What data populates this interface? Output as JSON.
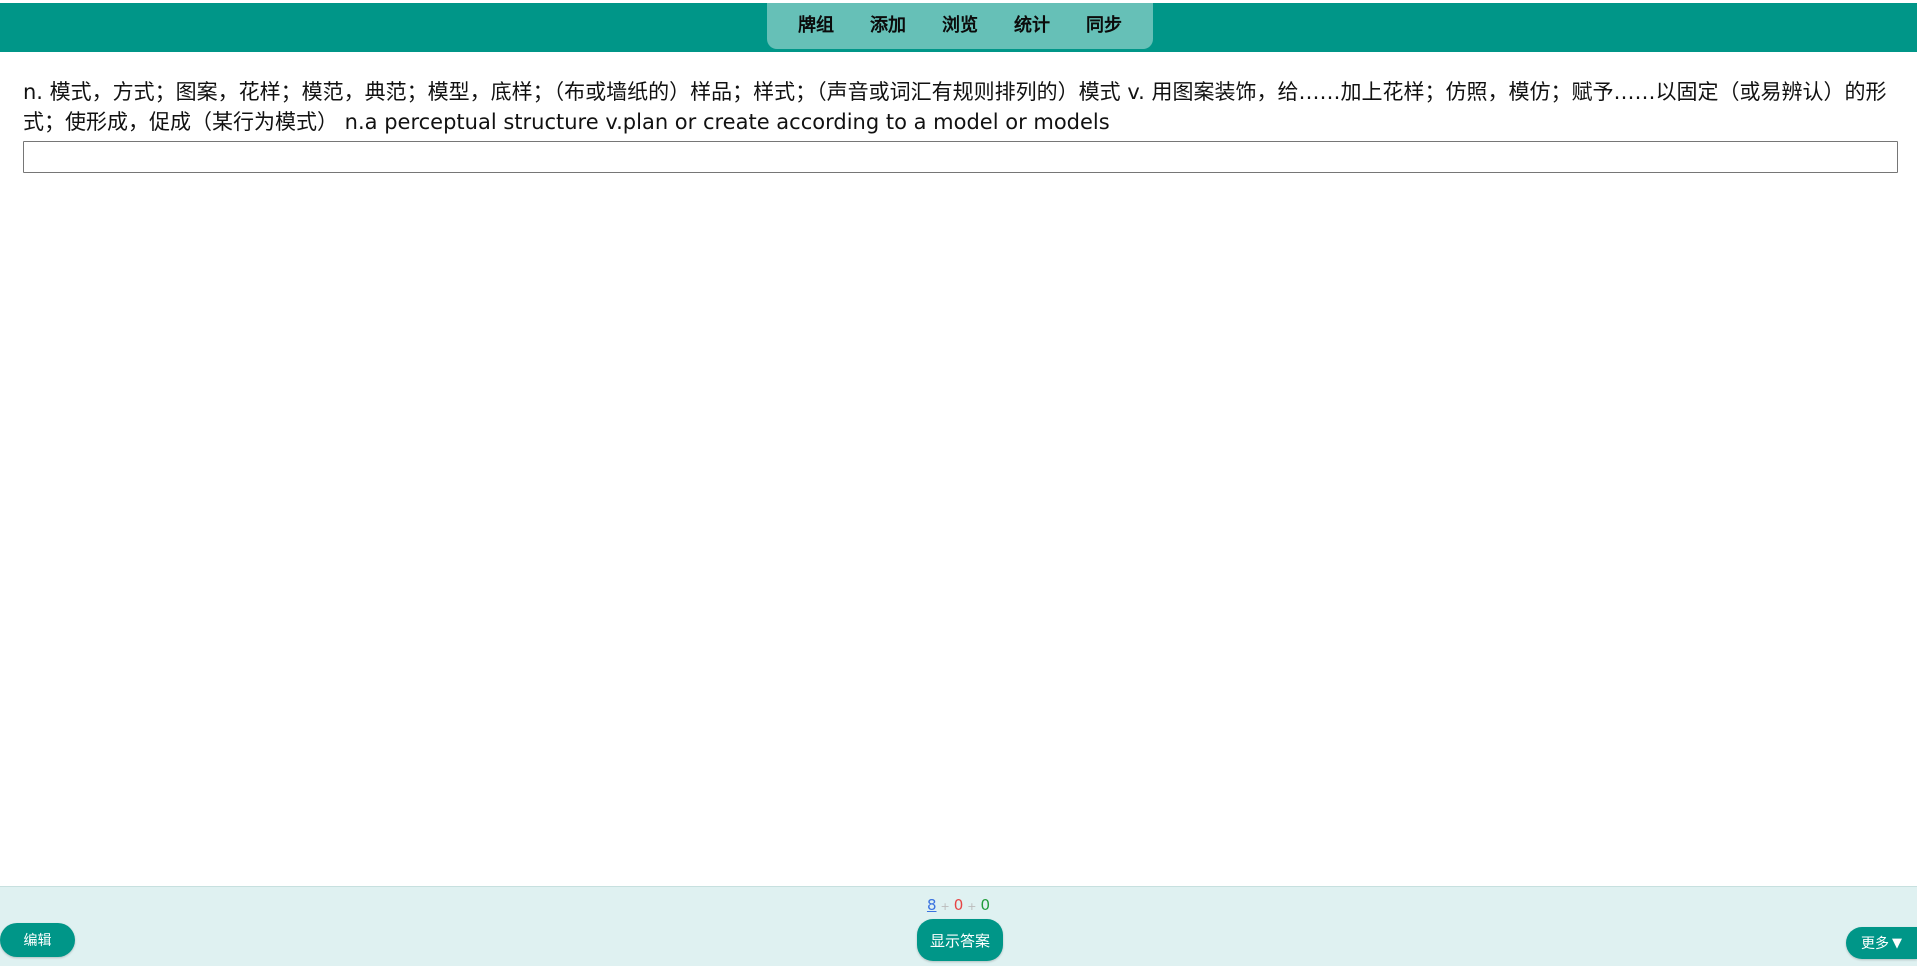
{
  "nav": {
    "items": [
      {
        "label": "牌组"
      },
      {
        "label": "添加"
      },
      {
        "label": "浏览"
      },
      {
        "label": "统计"
      },
      {
        "label": "同步"
      }
    ]
  },
  "card": {
    "definition": "n. 模式，方式；图案，花样；模范，典范；模型，底样；（布或墙纸的）样品；样式；（声音或词汇有规则排列的）模式 v. 用图案装饰，给……加上花样；仿照，模仿；赋予……以固定（或易辨认）的形式；使形成，促成（某行为模式） n.a perceptual structure v.plan or create according to a model or models",
    "answer_value": "",
    "answer_placeholder": ""
  },
  "counts": {
    "new": "8",
    "learning": "0",
    "review": "0",
    "separator": "+"
  },
  "buttons": {
    "edit": "编辑",
    "show_answer": "显示答案",
    "more": "更多",
    "more_icon": "▼"
  },
  "colors": {
    "primary": "#009688",
    "nav_highlight": "#66c0b7",
    "bottom_bar": "#dff1f1",
    "new_count": "#3b73e0",
    "learning_count": "#e64545",
    "review_count": "#1f9d3a"
  }
}
